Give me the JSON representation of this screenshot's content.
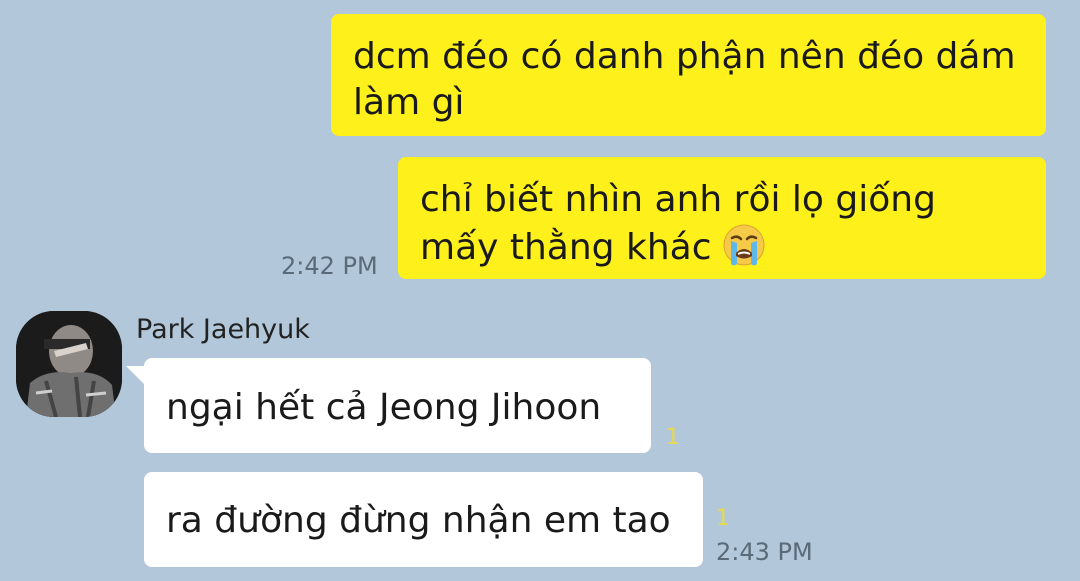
{
  "messages": [
    {
      "direction": "out",
      "text": "dcm đéo có danh phận nên đéo dám làm gì"
    },
    {
      "direction": "out",
      "text": "chỉ biết nhìn anh rồi lọ giống mấy thằng khác",
      "emoji": "loudly-crying-face-icon",
      "time": "2:42 PM"
    },
    {
      "direction": "in",
      "text": "ngại hết cả Jeong Jihoon",
      "unread": "1"
    },
    {
      "direction": "in",
      "text": "ra đường đừng nhận em tao",
      "unread": "1",
      "time": "2:43 PM"
    }
  ],
  "sender": {
    "name": "Park Jaehyuk"
  },
  "colors": {
    "background": "#b2c7d9",
    "outgoing_bubble": "#fef01b",
    "incoming_bubble": "#ffffff",
    "unread_counter": "#e8d84a"
  }
}
